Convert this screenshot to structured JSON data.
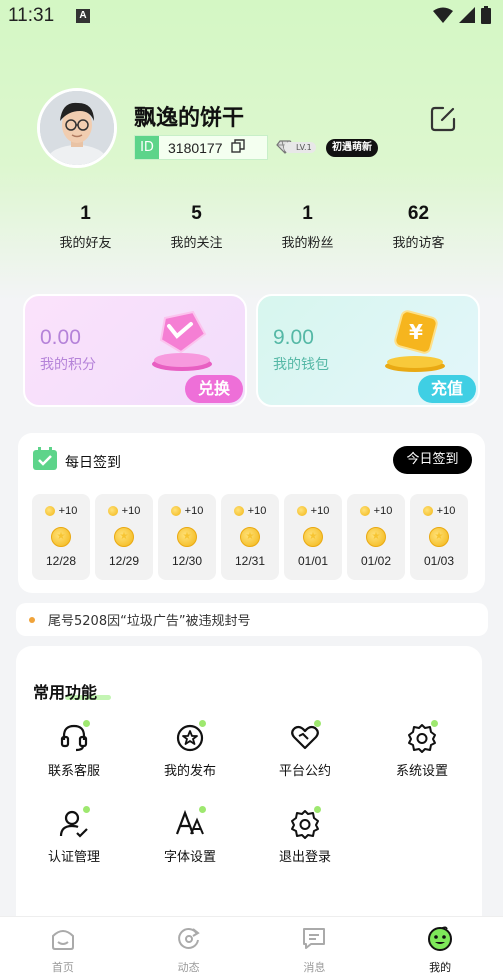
{
  "status_bar": {
    "time": "11:31",
    "notification_letter": "A"
  },
  "profile": {
    "username": "飘逸的饼干",
    "id_label": "ID",
    "id_value": "3180177",
    "level": "LV.1",
    "badge": "初遇萌新"
  },
  "stats": [
    {
      "value": "1",
      "label": "我的好友"
    },
    {
      "value": "5",
      "label": "我的关注"
    },
    {
      "value": "1",
      "label": "我的粉丝"
    },
    {
      "value": "62",
      "label": "我的访客"
    }
  ],
  "points_card": {
    "value": "0.00",
    "label": "我的积分",
    "button": "兑换"
  },
  "wallet_card": {
    "value": "9.00",
    "label": "我的钱包",
    "button": "充值"
  },
  "sign_in": {
    "title": "每日签到",
    "button": "今日签到",
    "days": [
      {
        "reward": "+10",
        "date": "12/28"
      },
      {
        "reward": "+10",
        "date": "12/29"
      },
      {
        "reward": "+10",
        "date": "12/30"
      },
      {
        "reward": "+10",
        "date": "12/31"
      },
      {
        "reward": "+10",
        "date": "01/01"
      },
      {
        "reward": "+10",
        "date": "01/02"
      },
      {
        "reward": "+10",
        "date": "01/03"
      }
    ]
  },
  "notice": {
    "text": "尾号5208因“垃圾广告”被违规封号"
  },
  "functions": {
    "title": "常用功能",
    "items": [
      {
        "label": "联系客服",
        "icon": "headset-icon"
      },
      {
        "label": "我的发布",
        "icon": "star-circle-icon"
      },
      {
        "label": "平台公约",
        "icon": "handshake-heart-icon"
      },
      {
        "label": "系统设置",
        "icon": "gear-icon"
      },
      {
        "label": "认证管理",
        "icon": "user-check-icon"
      },
      {
        "label": "字体设置",
        "icon": "font-icon"
      },
      {
        "label": "退出登录",
        "icon": "gear-logout-icon"
      }
    ]
  },
  "bottom_nav": [
    {
      "label": "首页",
      "icon": "home-icon",
      "active": false
    },
    {
      "label": "动态",
      "icon": "refresh-icon",
      "active": false
    },
    {
      "label": "消息",
      "icon": "message-icon",
      "active": false
    },
    {
      "label": "我的",
      "icon": "mascot-icon",
      "active": true
    }
  ],
  "colors": {
    "accent_green": "#5dd48a",
    "points_button": "#ee6fd8",
    "wallet_button": "#3fcfe4",
    "notice_dot": "#f0a33a"
  }
}
